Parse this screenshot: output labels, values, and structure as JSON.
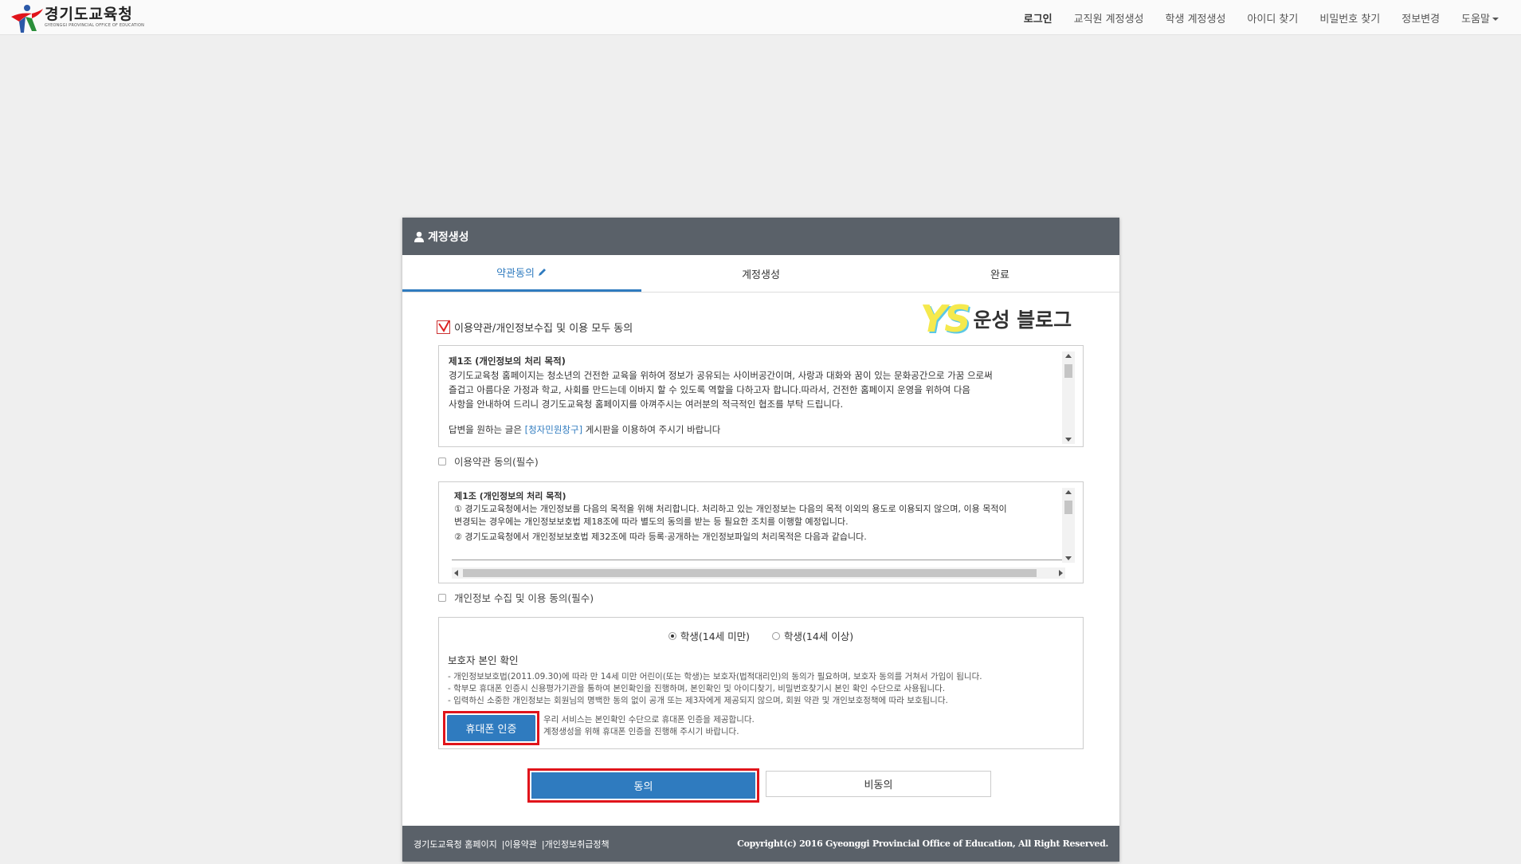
{
  "nav": {
    "logo_ko": "경기도교육청",
    "logo_en": "GYEONGGI PROVINCIAL OFFICE OF EDUCATION",
    "items": [
      "로그인",
      "교직원 계정생성",
      "학생 계정생성",
      "아이디 찾기",
      "비밀번호 찾기",
      "정보변경",
      "도움말"
    ]
  },
  "panel": {
    "title": "계정생성",
    "steps": [
      "약관동의",
      "계정생성",
      "완료"
    ],
    "all_agree": "이용약관/개인정보수집 및 이용 모두 동의",
    "watermark": {
      "ys": "YS",
      "text": "운성 블로그"
    },
    "terms1": {
      "title": "제1조 (개인정보의 처리 목적)",
      "line1": "경기도교육청 홈페이지는 청소년의 건전한 교육을 위하여 정보가 공유되는 사이버공간이며, 사랑과 대화와 꿈이 있는 문화공간으로 가꿈 으로써",
      "line2": "즐겁고 아름다운 가정과 학교, 사회를 만드는데 이바지 할 수 있도록 역할을 다하고자 합니다.따라서, 건전한 홈페이지 운영을 위하여 다음",
      "line3": "사항을 안내하여 드리니 경기도교육청 홈페이지를 아껴주시는 여러분의 적극적인 협조를 부탁 드립니다.",
      "line4a": "답변을 원하는 글은 ",
      "line4link": "[청자민원창구]",
      "line4b": " 게시판을 이용하여 주시기 바랍니다"
    },
    "terms1_check": "이용약관 동의(필수)",
    "terms2": {
      "title": "제1조 (개인정보의 처리 목적)",
      "line1": "① 경기도교육청에서는 개인정보를 다음의 목적을 위해 처리합니다. 처리하고 있는 개인정보는 다음의 목적 이외의 용도로 이용되지 않으며, 이용 목적이",
      "line2": "변경되는 경우에는 개인정보보호법 제18조에 따라 별도의 동의를 받는 등 필요한 조치를 이행할 예정입니다.",
      "line3": "② 경기도교육청에서 개인정보보호법 제32조에 따라 등록·공개하는 개인정보파일의 처리목적은 다음과 같습니다."
    },
    "terms2_check": "개인정보 수집 및 이용 동의(필수)",
    "verify": {
      "radio1": "학생(14세 미만)",
      "radio2": "학생(14세 이상)",
      "title": "보호자 본인 확인",
      "note1": "- 개인정보보호법(2011.09.30)에 따라 만 14세 미만 어린이(또는 학생)는 보호자(법적대리인)의 동의가 필요하며, 보호자 동의를 거쳐서 가입이 됩니다.",
      "note2": "- 학부모 휴대폰 인증시 신용평가기관을 통하여 본인확인을 진행하며, 본인확인 및 아이디찾기, 비밀번호찾기시 본인 확인 수단으로 사용됩니다.",
      "note3": "- 입력하신 소중한 개인정보는 회원님의 명백한 동의 없이 공개 또는 제3자에게 제공되지 않으며, 회원 약관 및 개인보호정책에 따라 보호됩니다.",
      "phone_button": "휴대폰 인증",
      "msg1": "우리 서비스는 본인확인 수단으로 휴대폰 인증을 제공합니다.",
      "msg2": "계정생성을 위해 휴대폰 인증을 진행해 주시기 바랍니다."
    },
    "agree": "동의",
    "disagree": "비동의",
    "footer": {
      "link1": "경기도교육청 홈페이지",
      "link2": "이용약관",
      "link3": "개인정보취급정책",
      "sep": "|",
      "copyright": "Copyright(c) 2016 Gyeonggi Provincial Office of Education, All Right Reserved."
    }
  }
}
